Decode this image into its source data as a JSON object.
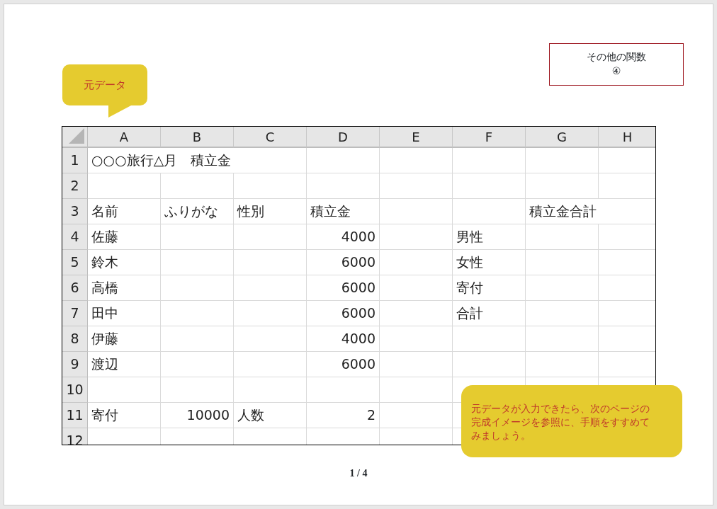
{
  "title_box": {
    "lines": [
      "その他の関数",
      "④"
    ]
  },
  "callout_top": {
    "text": "元データ"
  },
  "sheet": {
    "columns": [
      "A",
      "B",
      "C",
      "D",
      "E",
      "F",
      "G",
      "H"
    ],
    "rows": [
      {
        "number": "1",
        "cells": [
          {
            "text": "○○○旅行△月　積立金",
            "kind": "text"
          },
          null,
          null,
          null,
          null,
          null,
          null,
          null
        ]
      },
      {
        "number": "2",
        "cells": [
          null,
          null,
          null,
          null,
          null,
          null,
          null,
          null
        ]
      },
      {
        "number": "3",
        "cells": [
          {
            "text": "名前",
            "kind": "text"
          },
          {
            "text": "ふりがな",
            "kind": "text"
          },
          {
            "text": "性別",
            "kind": "text"
          },
          {
            "text": "積立金",
            "kind": "text"
          },
          null,
          null,
          {
            "text": "積立金合計",
            "kind": "text"
          },
          null
        ]
      },
      {
        "number": "4",
        "cells": [
          {
            "text": "佐藤",
            "kind": "text"
          },
          null,
          null,
          {
            "text": "4000",
            "kind": "number"
          },
          null,
          {
            "text": "男性",
            "kind": "text"
          },
          null,
          null
        ]
      },
      {
        "number": "5",
        "cells": [
          {
            "text": "鈴木",
            "kind": "text"
          },
          null,
          null,
          {
            "text": "6000",
            "kind": "number"
          },
          null,
          {
            "text": "女性",
            "kind": "text"
          },
          null,
          null
        ]
      },
      {
        "number": "6",
        "cells": [
          {
            "text": "高橋",
            "kind": "text"
          },
          null,
          null,
          {
            "text": "6000",
            "kind": "number"
          },
          null,
          {
            "text": "寄付",
            "kind": "text"
          },
          null,
          null
        ]
      },
      {
        "number": "7",
        "cells": [
          {
            "text": "田中",
            "kind": "text"
          },
          null,
          null,
          {
            "text": "6000",
            "kind": "number"
          },
          null,
          {
            "text": "合計",
            "kind": "text"
          },
          null,
          null
        ]
      },
      {
        "number": "8",
        "cells": [
          {
            "text": "伊藤",
            "kind": "text"
          },
          null,
          null,
          {
            "text": "4000",
            "kind": "number"
          },
          null,
          null,
          null,
          null
        ]
      },
      {
        "number": "9",
        "cells": [
          {
            "text": "渡辺",
            "kind": "text"
          },
          null,
          null,
          {
            "text": "6000",
            "kind": "number"
          },
          null,
          null,
          null,
          null
        ]
      },
      {
        "number": "10",
        "cells": [
          null,
          null,
          null,
          null,
          null,
          null,
          null,
          null
        ]
      },
      {
        "number": "11",
        "cells": [
          {
            "text": "寄付",
            "kind": "text"
          },
          {
            "text": "10000",
            "kind": "number"
          },
          {
            "text": "人数",
            "kind": "text"
          },
          {
            "text": "2",
            "kind": "number"
          },
          null,
          null,
          null,
          null
        ]
      },
      {
        "number": "12",
        "cells": [
          null,
          null,
          null,
          null,
          null,
          null,
          null,
          null
        ]
      }
    ]
  },
  "callout_bottom": {
    "text": "元データが入力できたら、次のページの完成イメージを参照に、手順をすすめてみましょう。"
  },
  "page_number": "1 / 4"
}
